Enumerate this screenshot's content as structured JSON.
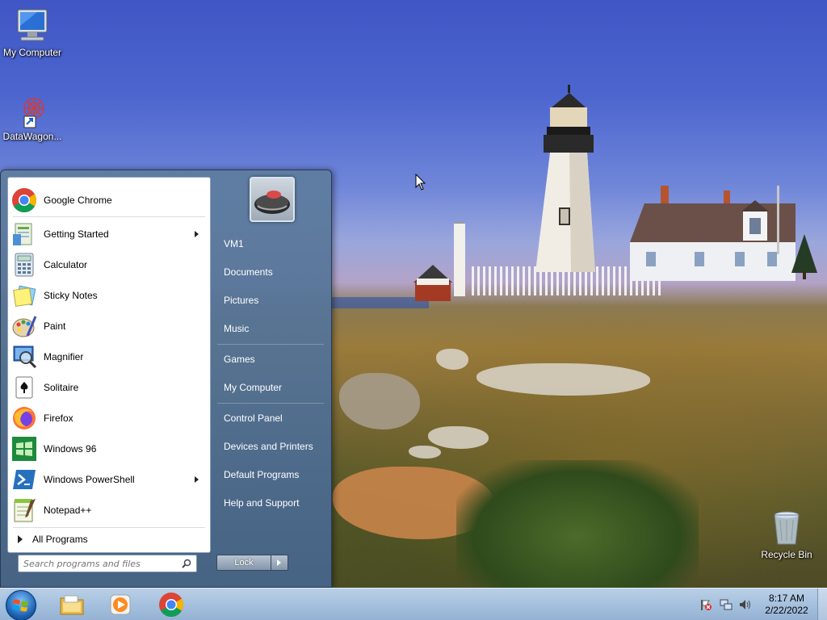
{
  "desktop": {
    "icons": [
      {
        "label": "My Computer"
      },
      {
        "label": "DataWagon..."
      },
      {
        "label": "Recycle Bin"
      }
    ]
  },
  "start_menu": {
    "programs": [
      {
        "label": "Google Chrome",
        "icon": "chrome-icon",
        "has_submenu": false
      },
      {
        "label": "Getting Started",
        "icon": "getting-started-icon",
        "has_submenu": true
      },
      {
        "label": "Calculator",
        "icon": "calculator-icon",
        "has_submenu": false
      },
      {
        "label": "Sticky Notes",
        "icon": "sticky-notes-icon",
        "has_submenu": false
      },
      {
        "label": "Paint",
        "icon": "paint-icon",
        "has_submenu": false
      },
      {
        "label": "Magnifier",
        "icon": "magnifier-icon",
        "has_submenu": false
      },
      {
        "label": "Solitaire",
        "icon": "solitaire-icon",
        "has_submenu": false
      },
      {
        "label": "Firefox",
        "icon": "firefox-icon",
        "has_submenu": false
      },
      {
        "label": "Windows 96",
        "icon": "windows96-icon",
        "has_submenu": false
      },
      {
        "label": "Windows PowerShell",
        "icon": "powershell-icon",
        "has_submenu": true
      },
      {
        "label": "Notepad++",
        "icon": "notepadpp-icon",
        "has_submenu": false
      }
    ],
    "all_programs": "All Programs",
    "search_placeholder": "Search programs and files",
    "right_items": [
      {
        "label": "VM1"
      },
      {
        "label": "Documents"
      },
      {
        "label": "Pictures"
      },
      {
        "label": "Music"
      },
      {
        "label": "Games"
      },
      {
        "label": "My Computer"
      },
      {
        "label": "Control Panel"
      },
      {
        "label": "Devices and Printers"
      },
      {
        "label": "Default Programs"
      },
      {
        "label": "Help and Support"
      }
    ],
    "lock_label": "Lock"
  },
  "taskbar": {
    "pinned": [
      "file-explorer-icon",
      "media-player-icon",
      "chrome-icon"
    ],
    "tray_icons": [
      "action-center-flag-icon",
      "network-icon",
      "volume-icon"
    ],
    "time": "8:17 AM",
    "date": "2/22/2022"
  },
  "colors": {
    "start_menu_bg": "#5f7da0",
    "taskbar_bg": "#a6c1de",
    "accent_blue": "#1a5fb0"
  }
}
